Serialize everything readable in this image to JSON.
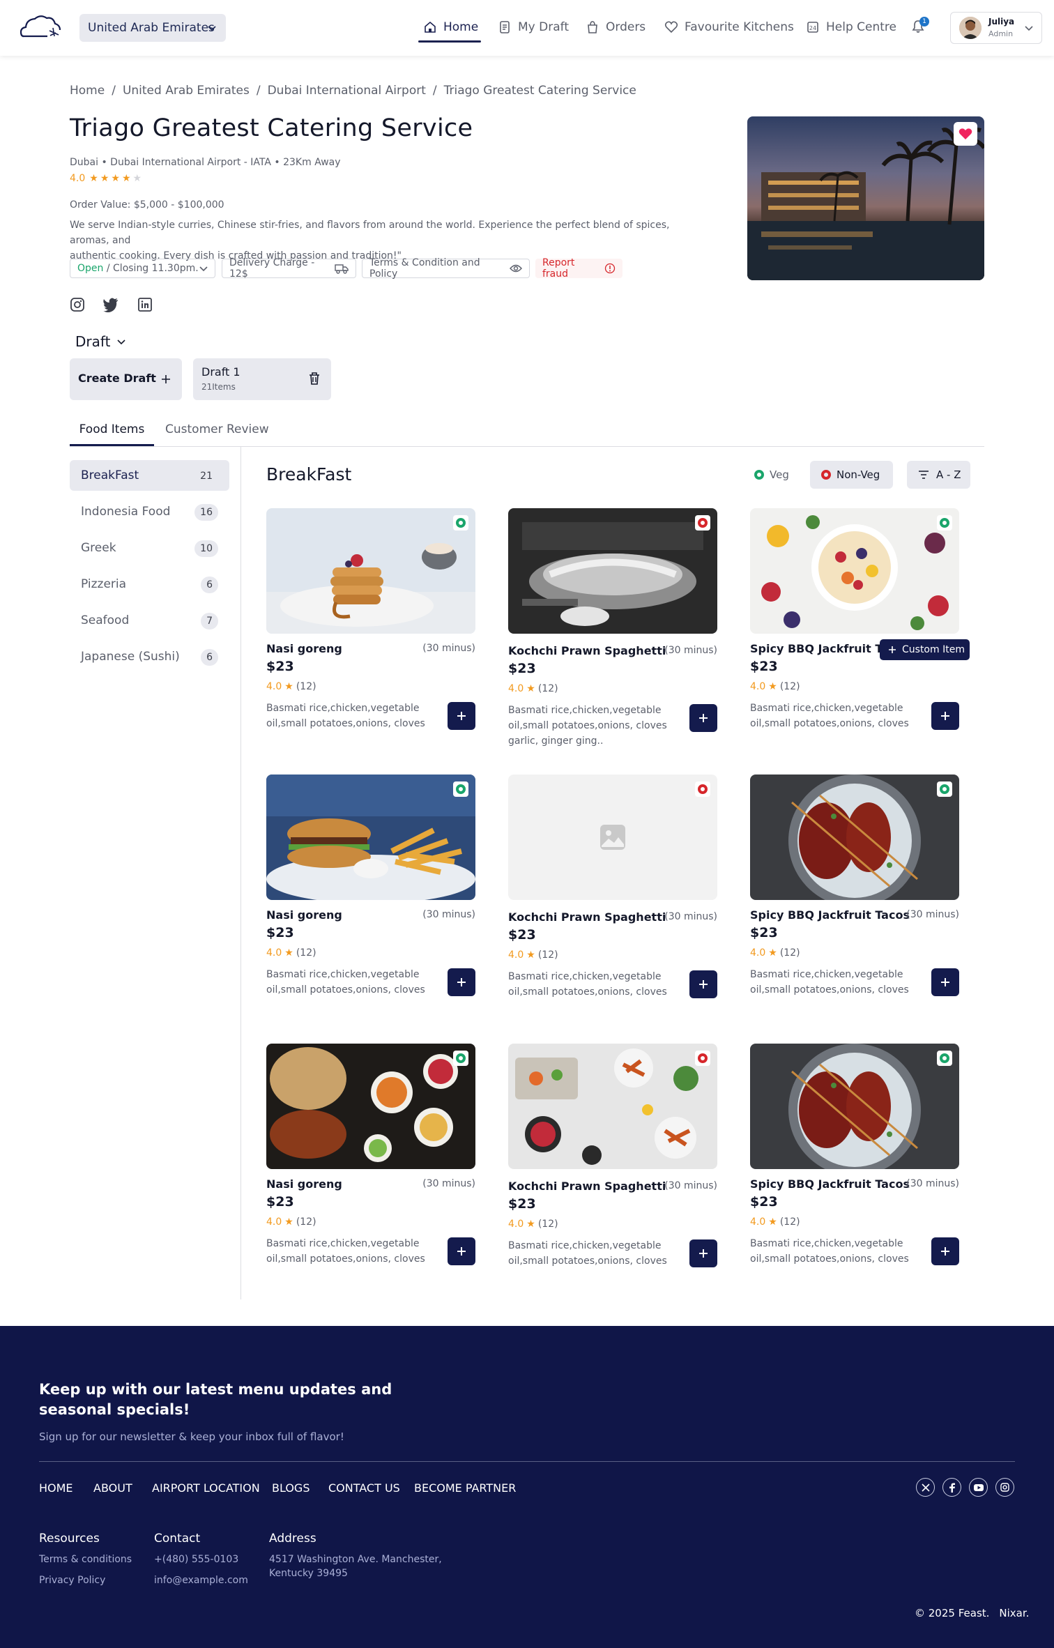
{
  "header": {
    "country": "United Arab Emirates",
    "nav": [
      {
        "label": "Home",
        "icon": "home-icon"
      },
      {
        "label": "My Draft",
        "icon": "draft-icon"
      },
      {
        "label": "Orders",
        "icon": "orders-icon"
      },
      {
        "label": "Favourite Kitchens",
        "icon": "heart-icon"
      },
      {
        "label": "Help Centre",
        "icon": "help-icon"
      }
    ],
    "notification_count": "1",
    "user": {
      "name": "Juliya",
      "role": "Admin"
    }
  },
  "breadcrumb": [
    "Home",
    "United Arab Emirates",
    "Dubai International Airport",
    "Triago Greatest Catering Service"
  ],
  "kitchen": {
    "title": "Triago Greatest Catering Service",
    "location": "Dubai • Dubai International Airport - IATA • 23Km Away",
    "rating": "4.0",
    "stars": 4,
    "order_value": "Order Value: $5,000 - $100,000",
    "description_line1": "We serve Indian-style curries, Chinese stir-fries, and flavors from around the world. Experience the perfect blend of spices, aromas, and",
    "description_line2": "authentic cooking. Every dish is crafted with passion and tradition!\"",
    "status_open": "Open",
    "status_closing": " / Closing 11.30pm.",
    "delivery": "Delivery Charge - 12$",
    "terms": "Terms & Condition and Policy",
    "report": "Report fraud"
  },
  "draft": {
    "label": "Draft",
    "create": "Create Draft",
    "draft_name": "Draft 1",
    "draft_items": "21Items"
  },
  "tabs": [
    "Food Items",
    "Customer Review"
  ],
  "categories": [
    {
      "name": "BreakFast",
      "count": "21"
    },
    {
      "name": "Indonesia Food",
      "count": "16"
    },
    {
      "name": "Greek",
      "count": "10"
    },
    {
      "name": "Pizzeria",
      "count": "6"
    },
    {
      "name": "Seafood",
      "count": "7"
    },
    {
      "name": "Japanese (Sushi)",
      "count": "6"
    }
  ],
  "section_title": "BreakFast",
  "filters": {
    "veg": "Veg",
    "nonveg": "Non-Veg",
    "sort": "A - Z"
  },
  "custom_item": "Custom Item",
  "items": [
    {
      "name": "Nasi goreng",
      "time": "(30 minus)",
      "price": "$23",
      "rating": "4.0",
      "reviews": "(12)",
      "desc": "Basmati rice,chicken,vegetable oil,small potatoes,onions, cloves",
      "veg": true
    },
    {
      "name": "Kochchi Prawn Spaghetti",
      "time": "(30 minus)",
      "price": "$23",
      "rating": "4.0",
      "reviews": "(12)",
      "desc": "Basmati rice,chicken,vegetable oil,small potatoes,onions, cloves garlic, ginger ging..",
      "veg": false
    },
    {
      "name": "Spicy BBQ Jackfruit Tacos",
      "time": "(30 minus)",
      "price": "$23",
      "rating": "4.0",
      "reviews": "(12)",
      "desc": "Basmati rice,chicken,vegetable oil,small potatoes,onions, cloves",
      "veg": true
    },
    {
      "name": "Nasi goreng",
      "time": "(30 minus)",
      "price": "$23",
      "rating": "4.0",
      "reviews": "(12)",
      "desc": "Basmati rice,chicken,vegetable oil,small potatoes,onions, cloves",
      "veg": true
    },
    {
      "name": "Kochchi Prawn Spaghetti",
      "time": "(30 minus)",
      "price": "$23",
      "rating": "4.0",
      "reviews": "(12)",
      "desc": "Basmati rice,chicken,vegetable oil,small potatoes,onions, cloves",
      "veg": false
    },
    {
      "name": "Spicy BBQ Jackfruit Tacos",
      "time": "(30 minus)",
      "price": "$23",
      "rating": "4.0",
      "reviews": "(12)",
      "desc": "Basmati rice,chicken,vegetable oil,small potatoes,onions, cloves",
      "veg": true
    },
    {
      "name": "Nasi goreng",
      "time": "(30 minus)",
      "price": "$23",
      "rating": "4.0",
      "reviews": "(12)",
      "desc": "Basmati rice,chicken,vegetable oil,small potatoes,onions, cloves",
      "veg": true
    },
    {
      "name": "Kochchi Prawn Spaghetti",
      "time": "(30 minus)",
      "price": "$23",
      "rating": "4.0",
      "reviews": "(12)",
      "desc": "Basmati rice,chicken,vegetable oil,small potatoes,onions, cloves",
      "veg": false
    },
    {
      "name": "Spicy BBQ Jackfruit Tacos",
      "time": "(30 minus)",
      "price": "$23",
      "rating": "4.0",
      "reviews": "(12)",
      "desc": "Basmati rice,chicken,vegetable oil,small potatoes,onions, cloves",
      "veg": true
    }
  ],
  "footer": {
    "headline_line1": "Keep up with our latest menu updates and",
    "headline_line2": "seasonal specials!",
    "subline": "Sign up for our newsletter & keep your inbox full of flavor!",
    "nav": [
      "HOME",
      "ABOUT",
      "AIRPORT LOCATION",
      "BLOGS",
      "CONTACT US",
      "BECOME PARTNER"
    ],
    "resources_title": "Resources",
    "resources": [
      "Terms & conditions",
      "Privacy Policy"
    ],
    "contact_title": "Contact",
    "contact": [
      "+(480) 555-0103",
      "info@example.com"
    ],
    "address_title": "Address",
    "address": [
      "4517 Washington Ave. Manchester,",
      "Kentucky 39495"
    ],
    "copyright": "© 2025 Feast.",
    "brand": "Nixar."
  },
  "colors": {
    "primary": "#141b4d",
    "veg": "#1aa56b",
    "nonveg": "#d6262b",
    "star": "#f29a1f",
    "heart": "#f0245e"
  }
}
